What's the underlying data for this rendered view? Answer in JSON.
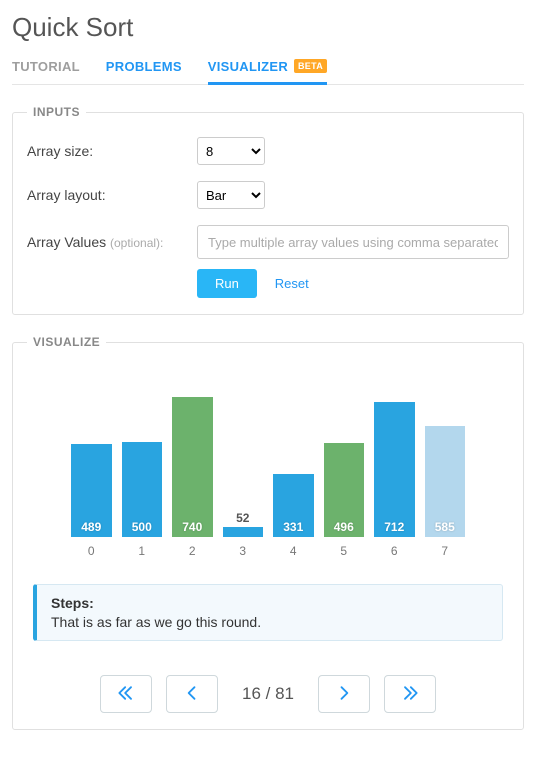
{
  "page_title": "Quick Sort",
  "tabs": {
    "tutorial": "TUTORIAL",
    "problems": "PROBLEMS",
    "visualizer": "VISUALIZER",
    "beta_badge": "BETA"
  },
  "inputs": {
    "legend": "INPUTS",
    "size_label": "Array size:",
    "size_value": "8",
    "layout_label": "Array layout:",
    "layout_value": "Bar",
    "values_label": "Array Values ",
    "values_opt": "(optional):",
    "values_placeholder": "Type multiple array values using comma separated",
    "run": "Run",
    "reset": "Reset"
  },
  "visualize": {
    "legend": "VISUALIZE",
    "step_title": "Steps:",
    "step_text": "That is as far as we go this round."
  },
  "pager": {
    "current": 16,
    "total": 81,
    "display": "16 / 81"
  },
  "chart_data": {
    "type": "bar",
    "categories": [
      "0",
      "1",
      "2",
      "3",
      "4",
      "5",
      "6",
      "7"
    ],
    "values": [
      489,
      500,
      740,
      52,
      331,
      496,
      712,
      585
    ],
    "bar_state": [
      "blue",
      "blue",
      "green",
      "blue",
      "blue",
      "green",
      "blue",
      "light"
    ],
    "highlight_bold": [
      false,
      false,
      true,
      false,
      false,
      true,
      false,
      false
    ],
    "ylim": [
      0,
      740
    ],
    "title": "",
    "xlabel": "",
    "ylabel": ""
  }
}
